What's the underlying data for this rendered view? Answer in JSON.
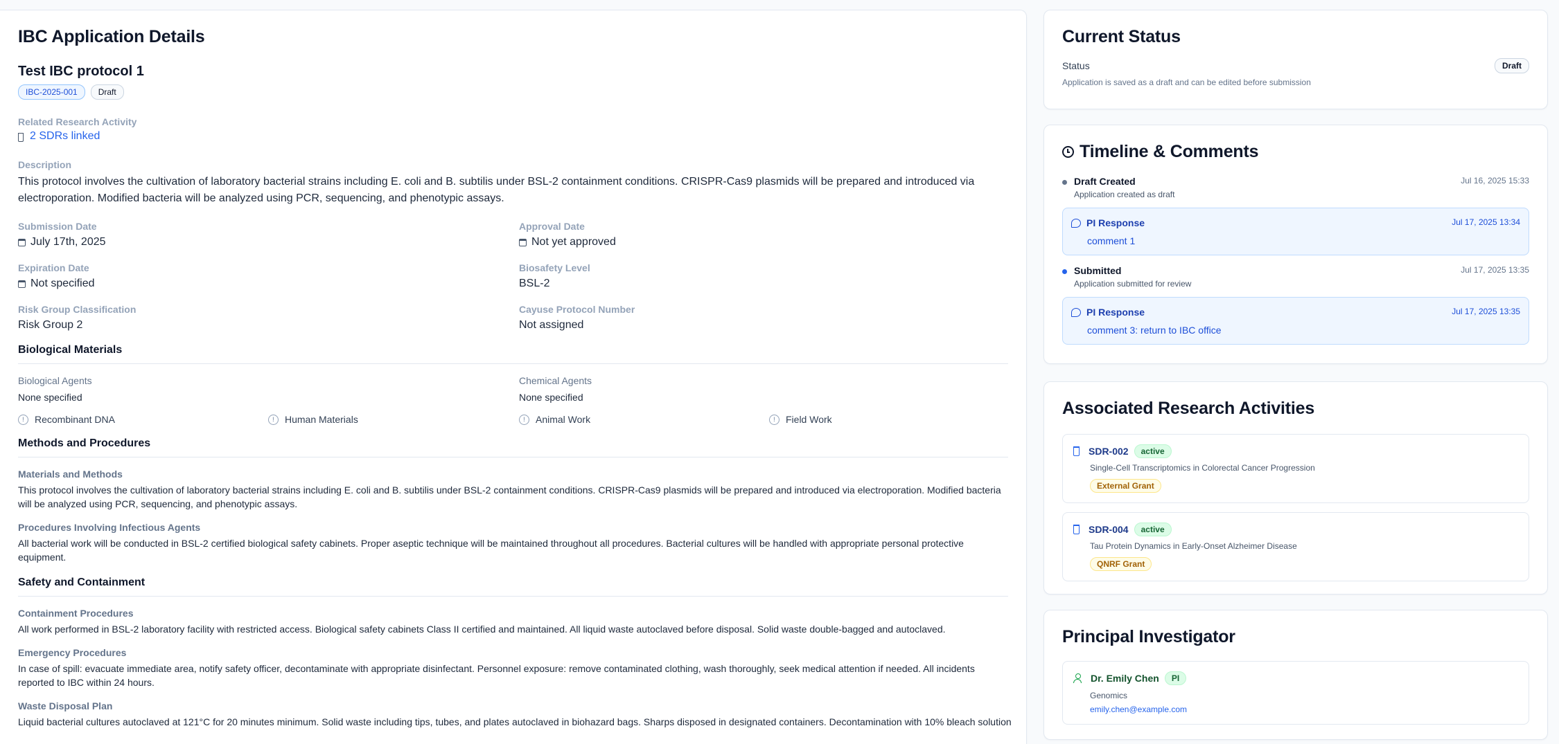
{
  "main": {
    "title": "IBC Application Details",
    "protocol_title": "Test IBC protocol 1",
    "protocol_id": "IBC-2025-001",
    "protocol_status": "Draft",
    "related_label": "Related Research Activity",
    "related_link": "2 SDRs linked",
    "description_label": "Description",
    "description": "This protocol involves the cultivation of laboratory bacterial strains including E. coli and B. subtilis under BSL-2 containment conditions. CRISPR-Cas9 plasmids will be prepared and introduced via electroporation. Modified bacteria will be analyzed using PCR, sequencing, and phenotypic assays.",
    "fields": {
      "submission_date_label": "Submission Date",
      "submission_date": "July 17th, 2025",
      "approval_date_label": "Approval Date",
      "approval_date": "Not yet approved",
      "expiration_date_label": "Expiration Date",
      "expiration_date": "Not specified",
      "biosafety_level_label": "Biosafety Level",
      "biosafety_level": "BSL-2",
      "risk_group_label": "Risk Group Classification",
      "risk_group": "Risk Group 2",
      "cayuse_label": "Cayuse Protocol Number",
      "cayuse": "Not assigned"
    },
    "bio_materials": {
      "heading": "Biological Materials",
      "agents_label": "Biological Agents",
      "agents": "None specified",
      "chemical_label": "Chemical Agents",
      "chemical": "None specified",
      "checks": [
        "Recombinant DNA",
        "Human Materials",
        "Animal Work",
        "Field Work"
      ]
    },
    "methods": {
      "heading": "Methods and Procedures",
      "materials_label": "Materials and Methods",
      "materials": "This protocol involves the cultivation of laboratory bacterial strains including E. coli and B. subtilis under BSL-2 containment conditions. CRISPR-Cas9 plasmids will be prepared and introduced via electroporation. Modified bacteria will be analyzed using PCR, sequencing, and phenotypic assays.",
      "infectious_label": "Procedures Involving Infectious Agents",
      "infectious": "All bacterial work will be conducted in BSL-2 certified biological safety cabinets. Proper aseptic technique will be maintained throughout all procedures. Bacterial cultures will be handled with appropriate personal protective equipment."
    },
    "safety": {
      "heading": "Safety and Containment",
      "containment_label": "Containment Procedures",
      "containment": "All work performed in BSL-2 laboratory facility with restricted access. Biological safety cabinets Class II certified and maintained. All liquid waste autoclaved before disposal. Solid waste double-bagged and autoclaved.",
      "emergency_label": "Emergency Procedures",
      "emergency": "In case of spill: evacuate immediate area, notify safety officer, decontaminate with appropriate disinfectant. Personnel exposure: remove contaminated clothing, wash thoroughly, seek medical attention if needed. All incidents reported to IBC within 24 hours.",
      "waste_label": "Waste Disposal Plan",
      "waste": "Liquid bacterial cultures autoclaved at 121°C for 20 minutes minimum. Solid waste including tips, tubes, and plates autoclaved in biohazard bags. Sharps disposed in designated containers. Decontamination with 10% bleach solution"
    }
  },
  "status_card": {
    "title": "Current Status",
    "status_label": "Status",
    "status_value": "Draft",
    "status_note": "Application is saved as a draft and can be edited before submission"
  },
  "timeline": {
    "title": "Timeline & Comments",
    "events": [
      {
        "type": "event",
        "name": "Draft Created",
        "desc": "Application created as draft",
        "time": "Jul 16, 2025 15:33",
        "dot": "#64748b"
      },
      {
        "type": "comment",
        "name": "PI Response",
        "text": "comment 1",
        "time": "Jul 17, 2025 13:34"
      },
      {
        "type": "event",
        "name": "Submitted",
        "desc": "Application submitted for review",
        "time": "Jul 17, 2025 13:35",
        "dot": "#2563eb"
      },
      {
        "type": "comment",
        "name": "PI Response",
        "text": "comment 3: return to IBC office",
        "time": "Jul 17, 2025 13:35"
      }
    ]
  },
  "research": {
    "title": "Associated Research Activities",
    "items": [
      {
        "id": "SDR-002",
        "status": "active",
        "title": "Single-Cell Transcriptomics in Colorectal Cancer Progression",
        "grant": "External Grant"
      },
      {
        "id": "SDR-004",
        "status": "active",
        "title": "Tau Protein Dynamics in Early-Onset Alzheimer Disease",
        "grant": "QNRF Grant"
      }
    ]
  },
  "pi": {
    "title": "Principal Investigator",
    "name": "Dr. Emily Chen",
    "role": "PI",
    "dept": "Genomics",
    "email": "emily.chen@example.com"
  }
}
